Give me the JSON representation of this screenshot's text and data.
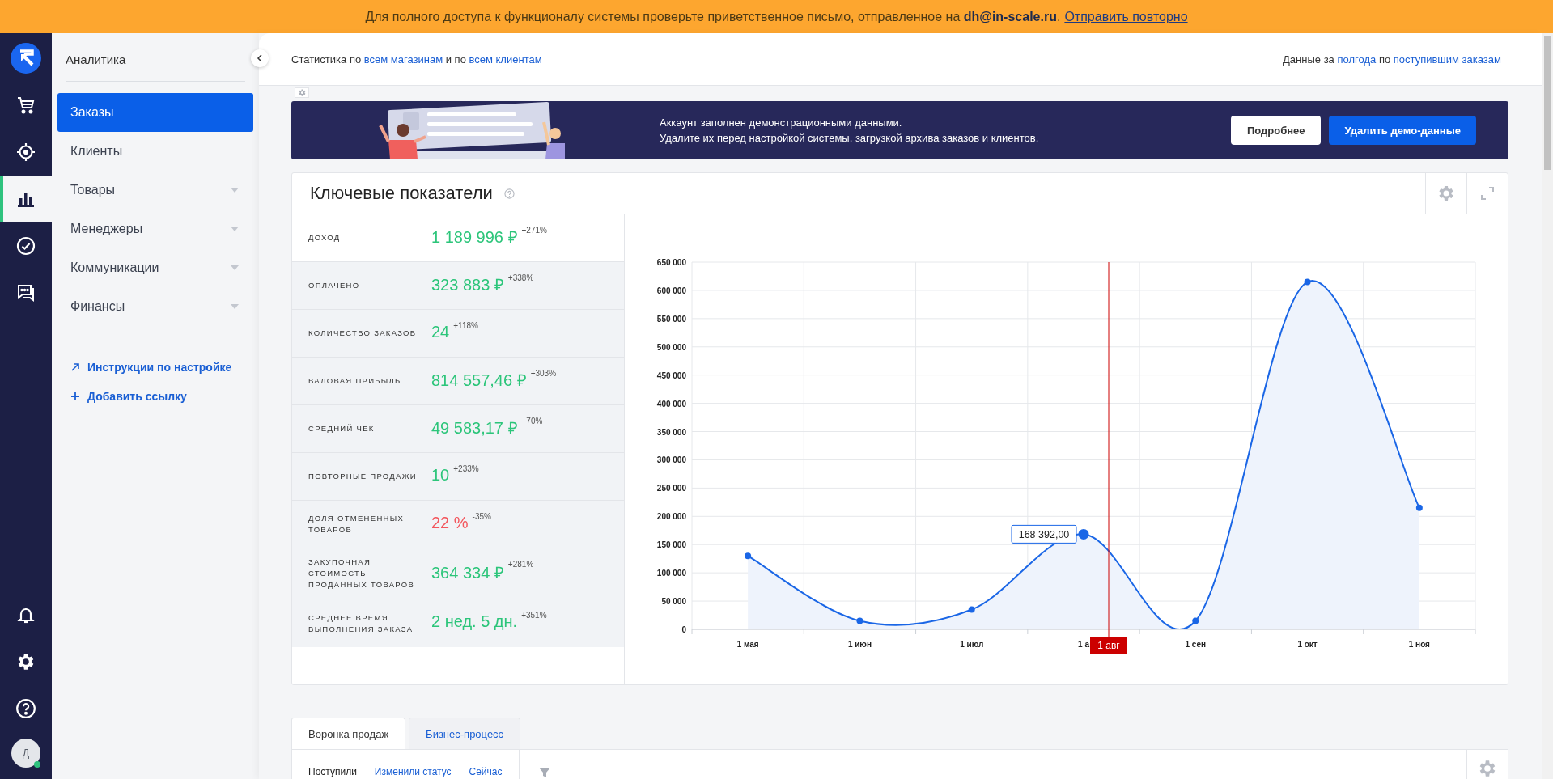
{
  "notice": {
    "text": "Для полного доступа к функционалу системы проверьте приветственное письмо, отправленное на **dh@in-scale.ru**.",
    "link": "Отправить повторно"
  },
  "rail": {
    "items": [
      {
        "kind": "cart",
        "selected": false
      },
      {
        "kind": "target",
        "selected": false
      },
      {
        "kind": "chart",
        "selected": true
      },
      {
        "kind": "check",
        "selected": false
      },
      {
        "kind": "chat",
        "selected": false
      }
    ],
    "bottom": [
      {
        "kind": "bell"
      },
      {
        "kind": "gear"
      },
      {
        "kind": "help"
      }
    ],
    "avatar": {
      "initial": "Д",
      "online": true
    }
  },
  "sidebar": {
    "title": "Аналитика",
    "items": [
      {
        "label": "Заказы",
        "selected": true,
        "expandable": false
      },
      {
        "label": "Клиенты",
        "selected": false,
        "expandable": false
      },
      {
        "label": "Товары",
        "selected": false,
        "expandable": true
      },
      {
        "label": "Менеджеры",
        "selected": false,
        "expandable": true
      },
      {
        "label": "Коммуникации",
        "selected": false,
        "expandable": true
      },
      {
        "label": "Финансы",
        "selected": false,
        "expandable": true
      }
    ],
    "links": [
      {
        "kind": "arrow",
        "label": "Инструкции по настройке"
      },
      {
        "kind": "plus",
        "label": "Добавить ссылку"
      }
    ]
  },
  "header": {
    "left": [
      {
        "kind": "text",
        "text": "Статистика по"
      },
      {
        "kind": "link",
        "text": "всем магазинам"
      },
      {
        "kind": "text",
        "text": "и по"
      },
      {
        "kind": "link",
        "text": "всем клиентам"
      }
    ],
    "right": [
      {
        "kind": "text",
        "text": "Данные за"
      },
      {
        "kind": "link",
        "text": "полгода"
      },
      {
        "kind": "text",
        "text": "по"
      },
      {
        "kind": "link",
        "text": "поступившим заказам"
      }
    ]
  },
  "banner": {
    "lines": [
      "Аккаунт заполнен демонстрационными данными.",
      "Удалите их перед настройкой системы, загрузкой архива заказов и клиентов."
    ],
    "buttons": [
      {
        "label": "Подробнее",
        "kind": "secondary"
      },
      {
        "label": "Удалить демо-данные",
        "kind": "primary"
      }
    ]
  },
  "metrics_card": {
    "title": "Ключевые показатели",
    "metrics": [
      {
        "label": "ДОХОД",
        "value": "1 189 996 ₽",
        "change": "+271%",
        "kind": "positive",
        "selected": true
      },
      {
        "label": "ОПЛАЧЕНО",
        "value": "323 883 ₽",
        "change": "+338%",
        "kind": "positive",
        "selected": false
      },
      {
        "label": "КОЛИЧЕСТВО ЗАКАЗОВ",
        "value": "24",
        "change": "+118%",
        "kind": "positive",
        "selected": false
      },
      {
        "label": "ВАЛОВАЯ ПРИБЫЛЬ",
        "value": "814 557,46 ₽",
        "change": "+303%",
        "kind": "positive",
        "selected": false
      },
      {
        "label": "СРЕДНИЙ ЧЕК",
        "value": "49 583,17 ₽",
        "change": "+70%",
        "kind": "positive",
        "selected": false
      },
      {
        "label": "ПОВТОРНЫЕ ПРОДАЖИ",
        "value": "10",
        "change": "+233%",
        "kind": "positive",
        "selected": false
      },
      {
        "label": "ДОЛЯ ОТМЕНЕННЫХ ТОВАРОВ",
        "value": "22 %",
        "change": "-35%",
        "kind": "negative",
        "selected": false
      },
      {
        "label": "ЗАКУПОЧНАЯ СТОИМОСТЬ ПРОДАННЫХ ТОВАРОВ",
        "value": "364 334 ₽",
        "change": "+281%",
        "kind": "positive",
        "selected": false
      },
      {
        "label": "СРЕДНЕЕ ВРЕМЯ ВЫПОЛНЕНИЯ ЗАКАЗА",
        "value": "2 нед. 5 дн.",
        "change": "+351%",
        "kind": "positive",
        "selected": false
      }
    ],
    "hover": {
      "value": "168 392,00",
      "date": "1 авг"
    },
    "chart_data": {
      "type": "area",
      "grid": true,
      "categories": [
        "1 мая",
        "1 июн",
        "1 июл",
        "1 а",
        "1 сен",
        "1 окт",
        "1 ноя"
      ],
      "series": [
        {
          "color": "#1a66e6",
          "values": [
            130000,
            15000,
            35000,
            168392,
            15000,
            615000,
            215000
          ]
        }
      ],
      "ylim": [
        0,
        650000
      ],
      "yticks": [
        {
          "value": 0,
          "label": "0"
        },
        {
          "value": 50000,
          "label": "50 000"
        },
        {
          "value": 100000,
          "label": "100 000"
        },
        {
          "value": 150000,
          "label": "150 000"
        },
        {
          "value": 200000,
          "label": "200 000"
        },
        {
          "value": 250000,
          "label": "250 000"
        },
        {
          "value": 300000,
          "label": "300 000"
        },
        {
          "value": 350000,
          "label": "350 000"
        },
        {
          "value": 400000,
          "label": "400 000"
        },
        {
          "value": 450000,
          "label": "450 000"
        },
        {
          "value": 500000,
          "label": "500 000"
        },
        {
          "value": 550000,
          "label": "550 000"
        },
        {
          "value": 600000,
          "label": "600 000"
        },
        {
          "value": 650000,
          "label": "650 000"
        }
      ]
    }
  },
  "bottom_tabs": [
    {
      "label": "Воронка продаж",
      "selected": true
    },
    {
      "label": "Бизнес-процесс",
      "selected": false
    }
  ],
  "filters": [
    {
      "label": "Поступили",
      "selected": true
    },
    {
      "label": "Изменили статус",
      "selected": false
    },
    {
      "label": "Сейчас",
      "selected": false
    }
  ]
}
